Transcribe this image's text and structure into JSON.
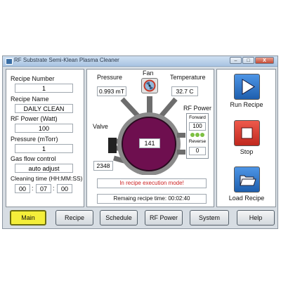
{
  "window": {
    "title": "RF Substrate Semi-Klean Plasma Cleaner",
    "minimize": "–",
    "maximize": "□",
    "close": "X"
  },
  "left_panel": {
    "recipe_number_label": "Recipe Number",
    "recipe_number": "1",
    "recipe_name_label": "Recipe Name",
    "recipe_name": "DAILY CLEAN",
    "rf_power_label": "RF Power (Watt)",
    "rf_power": "100",
    "pressure_label": "Pressure (mTorr)",
    "pressure": "1",
    "gas_flow_label": "Gas flow control",
    "gas_flow": "auto adjust",
    "cleaning_time_label": "Cleaning time (HH:MM:SS)",
    "time_hh": "00",
    "time_mm": "07",
    "time_ss": "00",
    "time_sep": ":"
  },
  "center_panel": {
    "pressure_label": "Pressure",
    "pressure_value": "0.993 mT",
    "fan_label": "Fan",
    "temperature_label": "Temperature",
    "temperature_value": "32.7 C",
    "valve_label": "Valve",
    "valve_value": "2348",
    "chamber_value": "141",
    "rf_power_label": "RF Power",
    "forward_label": "Forward",
    "forward_value": "100",
    "reverse_label": "Reverse",
    "reverse_value": "0",
    "status_message": "In recipe execution mode!",
    "remaining_time": "Remaing recipe time: 00:02:40"
  },
  "right_panel": {
    "run_label": "Run Recipe",
    "stop_label": "Stop",
    "load_label": "Load Recipe"
  },
  "nav": {
    "main": "Main",
    "recipe": "Recipe",
    "schedule": "Schedule",
    "rf_power": "RF Power",
    "system": "System",
    "help": "Help"
  },
  "colors": {
    "chamber": "#6e0f4f",
    "run": "#2a73c9",
    "stop": "#d8332a",
    "load": "#2a73c9",
    "active_tab": "#f4ee3a",
    "status_text": "#cc2222",
    "led_green": "#7dc043"
  },
  "icons": {
    "fan": "fan-icon",
    "run": "play-icon",
    "stop": "stop-icon",
    "load": "folder-icon"
  }
}
